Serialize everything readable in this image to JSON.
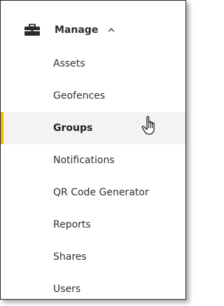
{
  "menu": {
    "section_label": "Manage",
    "section_icon": "briefcase-icon",
    "caret_icon": "chevron-up-icon",
    "active_color": "#f2b90f",
    "items": [
      {
        "label": "Assets"
      },
      {
        "label": "Geofences"
      },
      {
        "label": "Groups",
        "active": true
      },
      {
        "label": "Notifications"
      },
      {
        "label": "QR Code Generator"
      },
      {
        "label": "Reports"
      },
      {
        "label": "Shares"
      },
      {
        "label": "Users"
      }
    ]
  },
  "pointer": {
    "icon": "hand-pointer-icon"
  }
}
